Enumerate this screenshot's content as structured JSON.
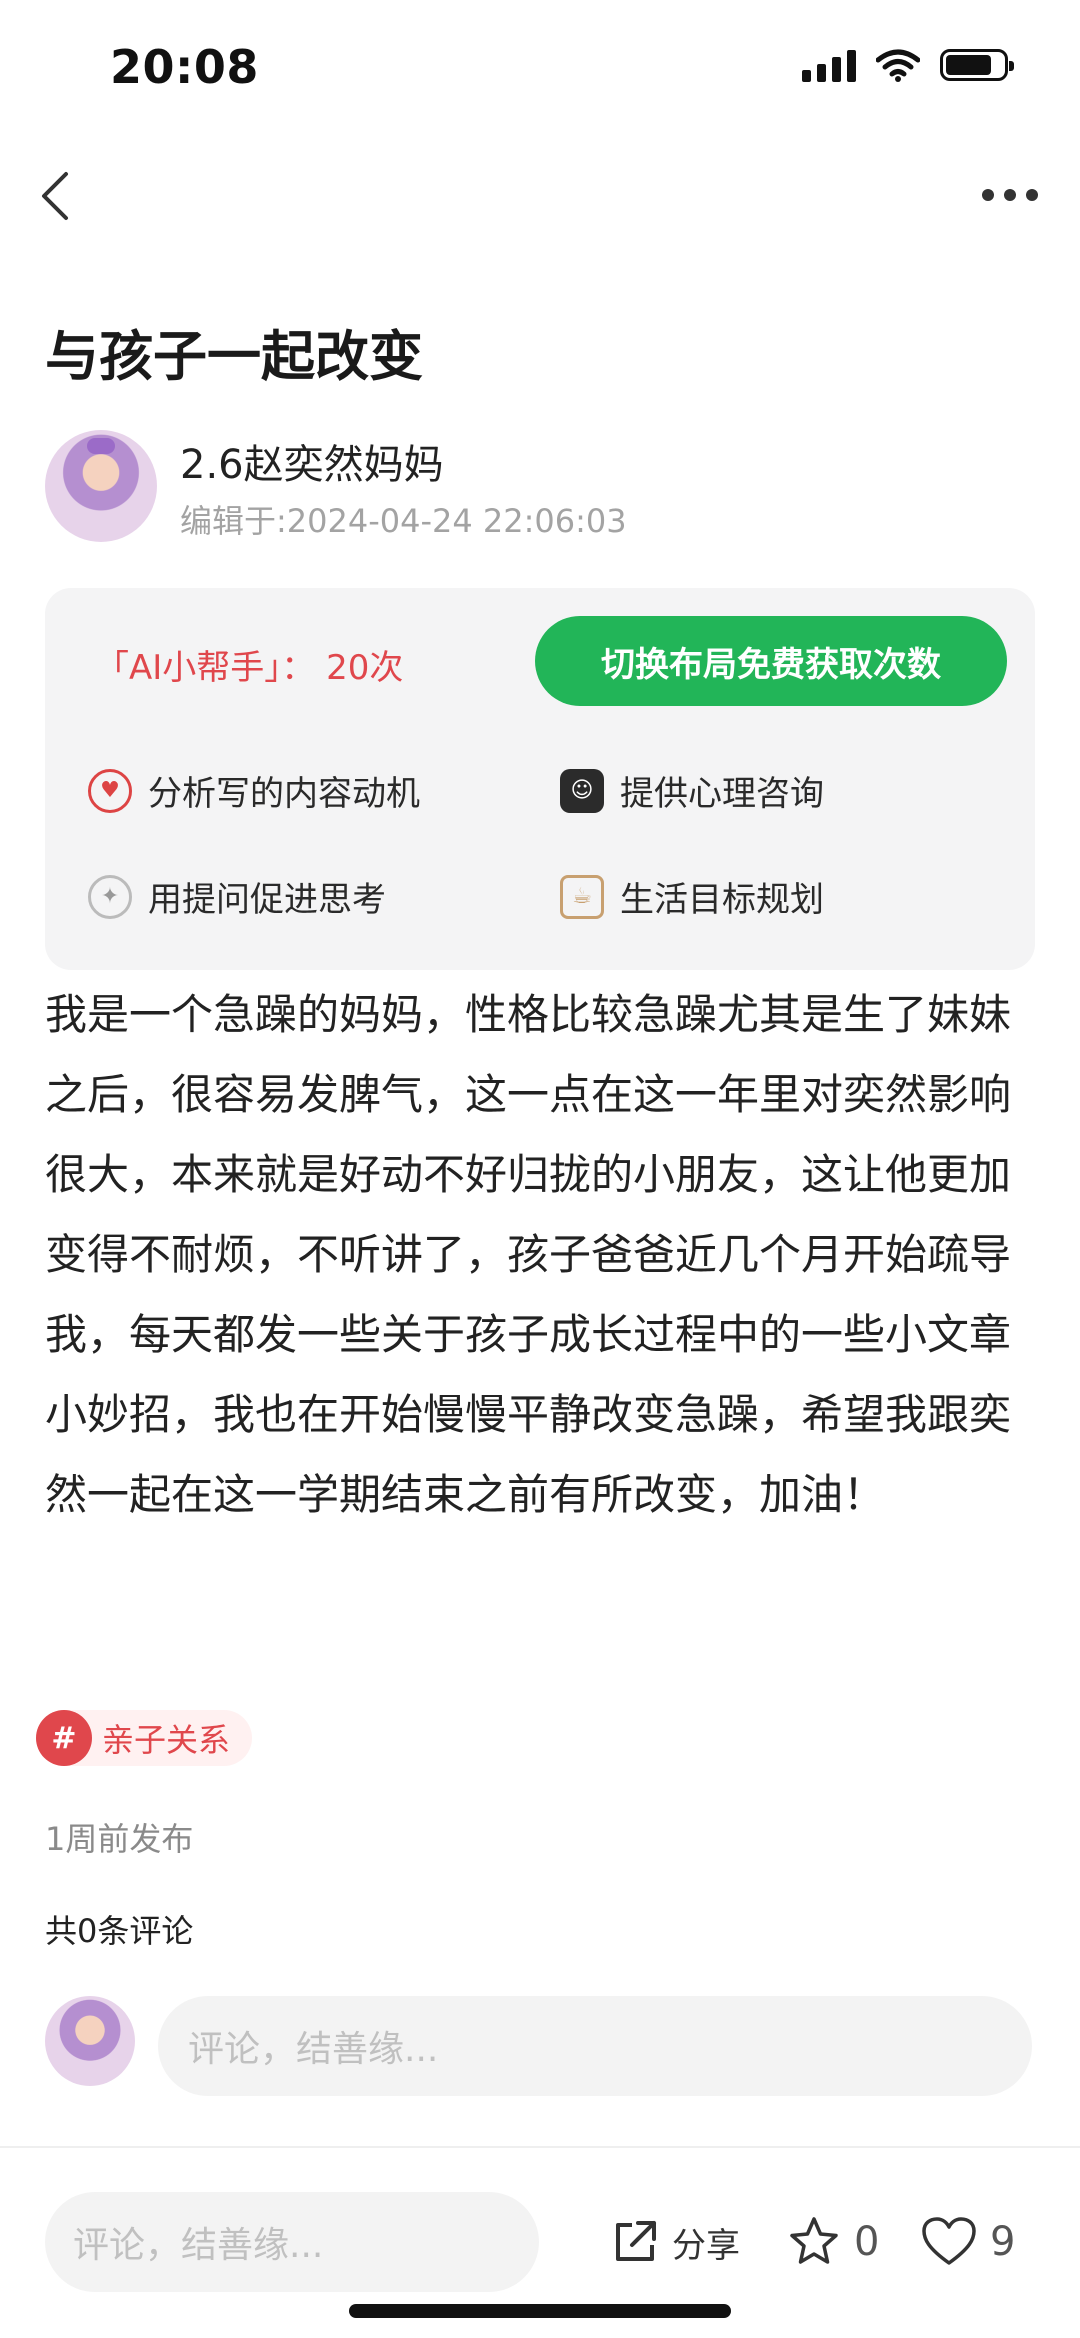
{
  "status_bar": {
    "time": "20:08",
    "battery_level": 0.8
  },
  "nav": {
    "back_icon": "chevron-left-icon",
    "more_icon": "more-dots-icon"
  },
  "post": {
    "title": "与孩子一起改变",
    "author": "2.6赵奕然妈妈",
    "edited": "编辑于:2024-04-24 22:06:03",
    "body": "我是一个急躁的妈妈，性格比较急躁尤其是生了妹妹之后，很容易发脾气，这一点在这一年里对奕然影响很大，本来就是好动不好归拢的小朋友，这让他更加变得不耐烦，不听讲了，孩子爸爸近几个月开始疏导我，每天都发一些关于孩子成长过程中的一些小文章小妙招，我也在开始慢慢平静改变急躁，希望我跟奕然一起在这一学期结束之前有所改变，加油！",
    "tag_hash": "#",
    "tag": "亲子关系",
    "posted": "1周前发布",
    "comments_count": "共0条评论"
  },
  "ai_panel": {
    "quota": "「AI小帮手」： 20次",
    "button": "切换布局免费获取次数",
    "features": [
      {
        "label": "分析写的内容动机",
        "icon": "target-heart-icon"
      },
      {
        "label": "提供心理咨询",
        "icon": "smile-face-icon"
      },
      {
        "label": "用提问促进思考",
        "icon": "lightbulb-icon"
      },
      {
        "label": "生活目标规划",
        "icon": "coffee-cup-icon"
      }
    ]
  },
  "comment": {
    "placeholder": "评论，结善缘..."
  },
  "bottom_bar": {
    "placeholder": "评论，结善缘...",
    "share_label": "分享",
    "favorites": "0",
    "likes": "9"
  },
  "colors": {
    "accent_green": "#22b558",
    "accent_red": "#e0474c"
  }
}
